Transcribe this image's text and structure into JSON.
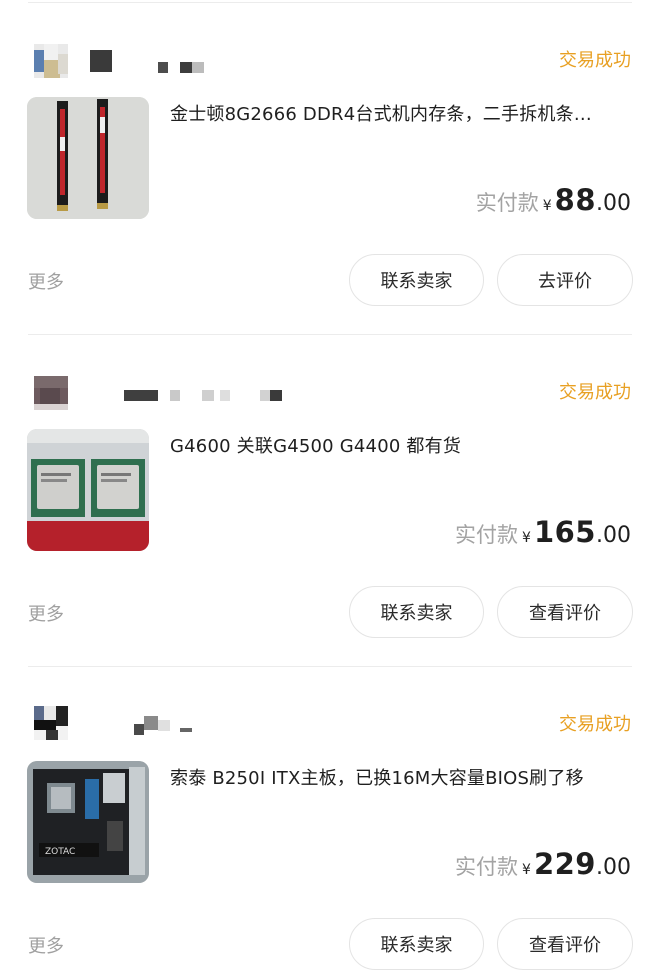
{
  "orders": [
    {
      "status": "交易成功",
      "title": "金士顿8G2666 DDR4台式机内存条，二手拆机条…",
      "price_label": "实付款",
      "currency": "¥",
      "price_integer": "88",
      "price_decimal": ".00",
      "more_label": "更多",
      "contact_label": "联系卖家",
      "review_label": "去评价",
      "thumbnail_icon": "ram-stick-icon"
    },
    {
      "status": "交易成功",
      "title": "G4600 关联G4500 G4400 都有货",
      "price_label": "实付款",
      "currency": "¥",
      "price_integer": "165",
      "price_decimal": ".00",
      "more_label": "更多",
      "contact_label": "联系卖家",
      "review_label": "查看评价",
      "thumbnail_icon": "cpu-chip-icon"
    },
    {
      "status": "交易成功",
      "title": "索泰 B250I ITX主板，已换16M大容量BIOS刷了移",
      "price_label": "实付款",
      "currency": "¥",
      "price_integer": "229",
      "price_decimal": ".00",
      "more_label": "更多",
      "contact_label": "联系卖家",
      "review_label": "查看评价",
      "thumbnail_icon": "motherboard-icon"
    }
  ],
  "colors": {
    "status": "#e8a023",
    "muted": "#a0a0a0",
    "text": "#1f1f1f",
    "button_border": "#e4e4e4"
  }
}
